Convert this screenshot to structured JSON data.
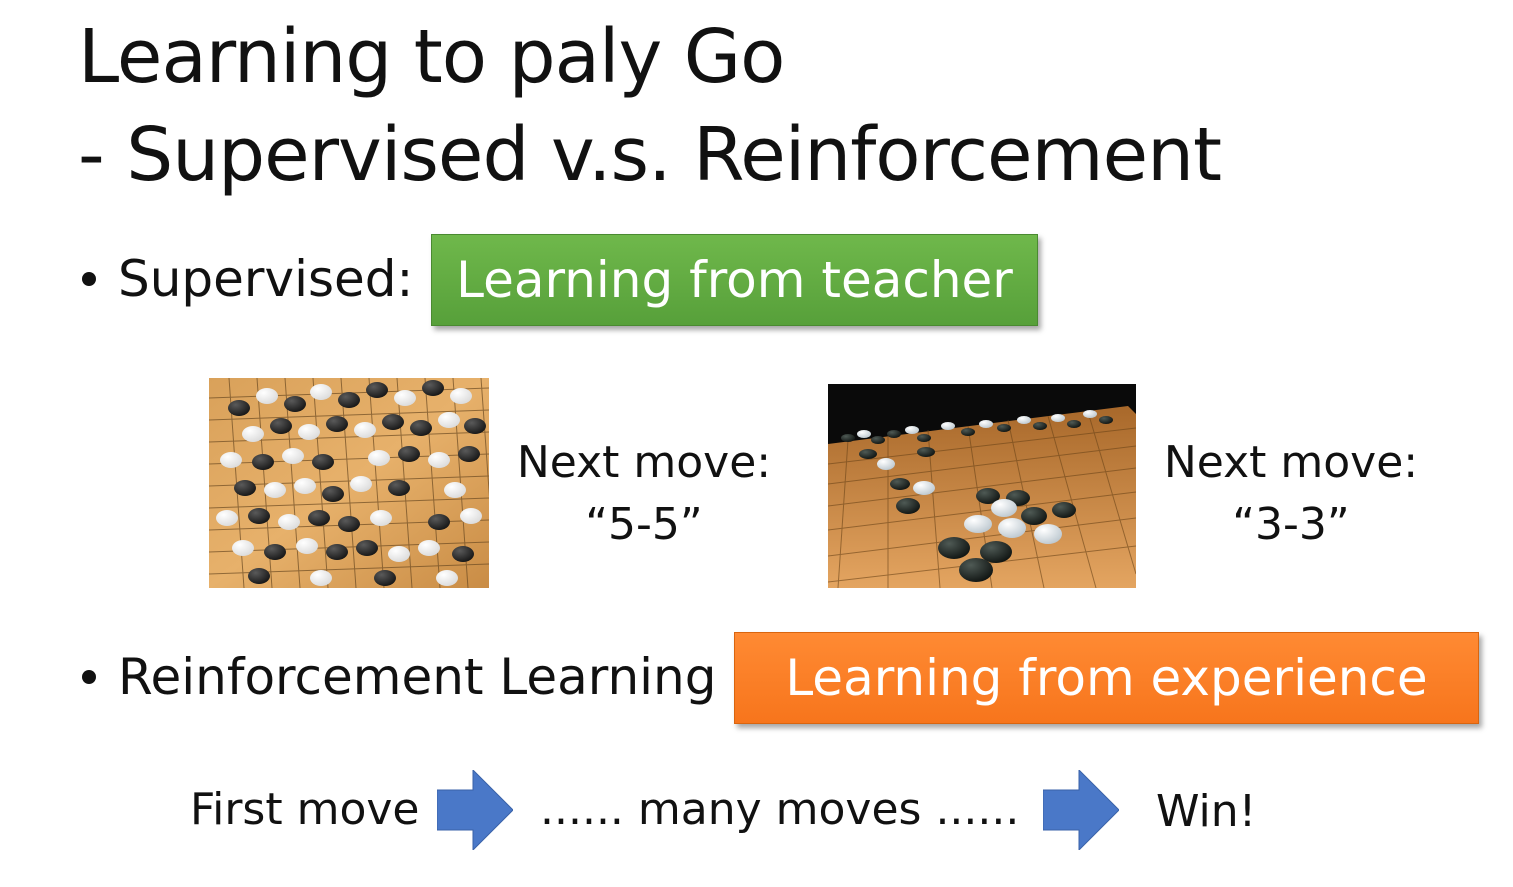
{
  "slide": {
    "title_line1": "Learning to paly Go",
    "title_line2": "- Supervised v.s. Reinforcement"
  },
  "supervised": {
    "label": "Supervised:",
    "tag": "Learning from teacher",
    "tag_color": "#5fa843",
    "examples": [
      {
        "image": "go-board-photo",
        "caption_line1": "Next move:",
        "caption_line2": "“5-5”"
      },
      {
        "image": "go-board-photo",
        "caption_line1": "Next move:",
        "caption_line2": "“3-3”"
      }
    ]
  },
  "reinforcement": {
    "label": "Reinforcement Learning",
    "tag": "Learning from experience",
    "tag_color": "#f97d22",
    "flow": {
      "step1": "First move",
      "step2": "...... many moves ......",
      "step3": "Win!",
      "arrow_color": "#4a78c8",
      "arrow_icon": "right-arrow-icon"
    }
  }
}
